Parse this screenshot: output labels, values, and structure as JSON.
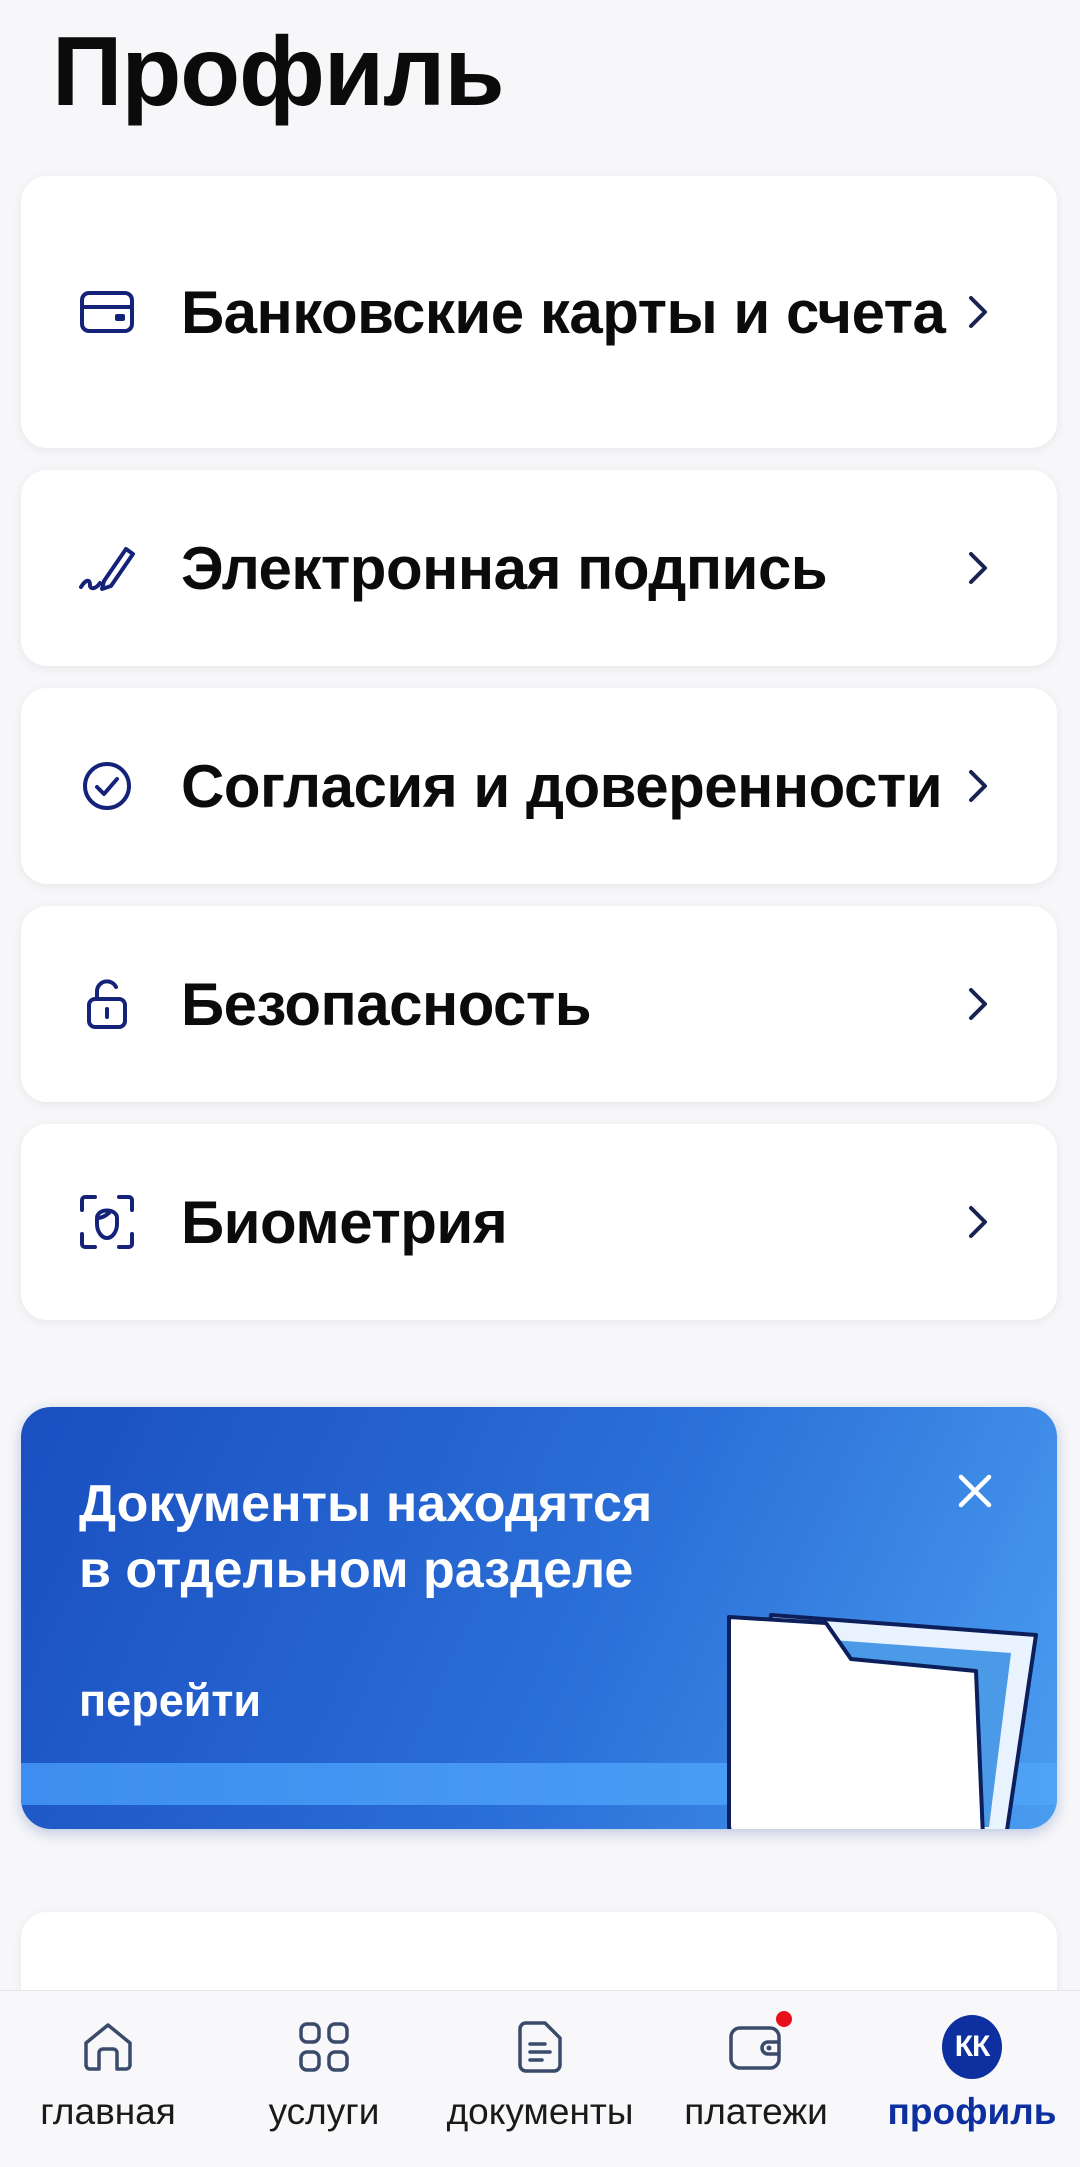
{
  "header": {
    "title": "Профиль"
  },
  "menu": {
    "items": [
      {
        "label": "Банковские карты и счета",
        "icon": "bank-card-icon"
      },
      {
        "label": "Электронная подпись",
        "icon": "signature-pen-icon"
      },
      {
        "label": "Согласия и доверенности",
        "icon": "check-circle-icon"
      },
      {
        "label": "Безопасность",
        "icon": "lock-icon"
      },
      {
        "label": "Биометрия",
        "icon": "face-scan-icon"
      }
    ]
  },
  "promo": {
    "title_line1": "Документы находятся",
    "title_line2": "в отдельном разделе",
    "link": "перейти",
    "close_icon": "close-icon",
    "illustration": "folder-icon"
  },
  "tabbar": {
    "tabs": [
      {
        "label": "главная",
        "icon": "home-icon",
        "active": false
      },
      {
        "label": "услуги",
        "icon": "grid-icon",
        "active": false
      },
      {
        "label": "документы",
        "icon": "document-icon",
        "active": false
      },
      {
        "label": "платежи",
        "icon": "wallet-icon",
        "active": false,
        "notification": true
      },
      {
        "label": "профиль",
        "icon": "avatar",
        "active": true,
        "avatar_initials": "КК"
      }
    ]
  },
  "colors": {
    "accent": "#0d2fa0",
    "promo_blue": "#2b6fd8",
    "notification": "#e8101a"
  }
}
